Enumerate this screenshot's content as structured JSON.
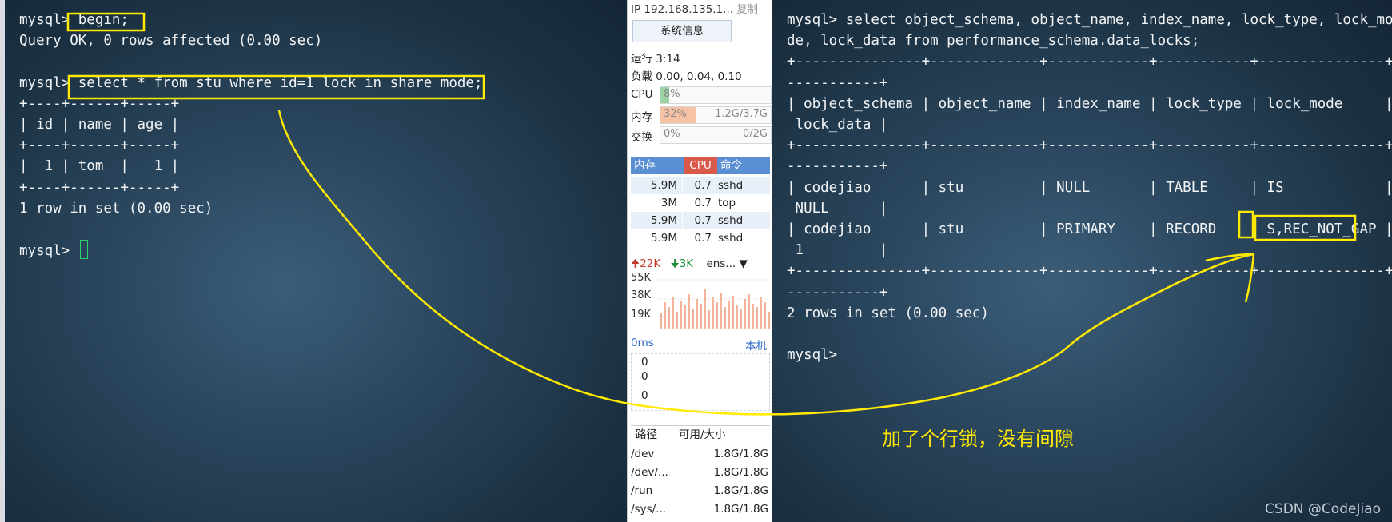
{
  "left_terminal": {
    "lines": [
      "mysql> begin;",
      "Query OK, 0 rows affected (0.00 sec)",
      "",
      "mysql> select * from stu where id=1 lock in share mode;",
      "+----+------+-----+",
      "| id | name | age |",
      "+----+------+-----+",
      "|  1 | tom  |   1 |",
      "+----+------+-----+",
      "1 row in set (0.00 sec)",
      "",
      "mysql> "
    ]
  },
  "right_terminal": {
    "lines": [
      "mysql> select object_schema, object_name, index_name, lock_type, lock_mo",
      "de, lock_data from performance_schema.data_locks;",
      "+---------------+-------------+------------+-----------+---------------+",
      "-----------+",
      "| object_schema | object_name | index_name | lock_type | lock_mode     |",
      " lock_data |",
      "+---------------+-------------+------------+-----------+---------------+",
      "-----------+",
      "| codejiao      | stu         | NULL       | TABLE     | IS            |",
      " NULL      |",
      "| codejiao      | stu         | PRIMARY    | RECORD    | S,REC_NOT_GAP |",
      " 1         |",
      "+---------------+-------------+------------+-----------+---------------+",
      "-----------+",
      "2 rows in set (0.00 sec)",
      "",
      "mysql> "
    ]
  },
  "monitor": {
    "ip": "IP 192.168.135.1...",
    "copy": "复制",
    "sys_info_button": "系统信息",
    "uptime": "运行 3:14",
    "load": "负载 0.00, 0.04, 0.10",
    "cpu_label": "CPU",
    "cpu_pct": "8%",
    "cpu_fraction": 0.08,
    "mem_label": "内存",
    "mem_pct": "32%",
    "mem_fraction": 0.32,
    "mem_usage": "1.2G/3.7G",
    "swap_label": "交换",
    "swap_pct": "0%",
    "swap_usage": "0/2G",
    "proc_headers": [
      "内存",
      "CPU",
      "命令"
    ],
    "processes": [
      {
        "mem": "5.9M",
        "cpu": "0.7",
        "cmd": "sshd"
      },
      {
        "mem": "3M",
        "cpu": "0.7",
        "cmd": "top"
      },
      {
        "mem": "5.9M",
        "cpu": "0.7",
        "cmd": "sshd"
      },
      {
        "mem": "5.9M",
        "cpu": "0.7",
        "cmd": "sshd"
      }
    ],
    "net_up": "22K",
    "net_down": "3K",
    "net_iface": "ens...",
    "graph_labels": [
      "55K",
      "38K",
      "19K"
    ],
    "latency": "0ms",
    "latency_host": "本机",
    "latency_values": [
      "0",
      "0",
      "0"
    ],
    "disk_headers": [
      "路径",
      "可用/大小"
    ],
    "disks": [
      {
        "path": "/dev",
        "size": "1.8G/1.8G"
      },
      {
        "path": "/dev/...",
        "size": "1.8G/1.8G"
      },
      {
        "path": "/run",
        "size": "1.8G/1.8G"
      },
      {
        "path": "/sys/...",
        "size": "1.8G/1.8G"
      }
    ]
  },
  "annotation_text": "加了个行锁，没有间隙",
  "watermark": "CSDN @CodeJiao",
  "colors": {
    "highlight": "#ffea00",
    "cpu_fill": "#9bd3a4",
    "mem_fill": "#f5c3a3"
  }
}
